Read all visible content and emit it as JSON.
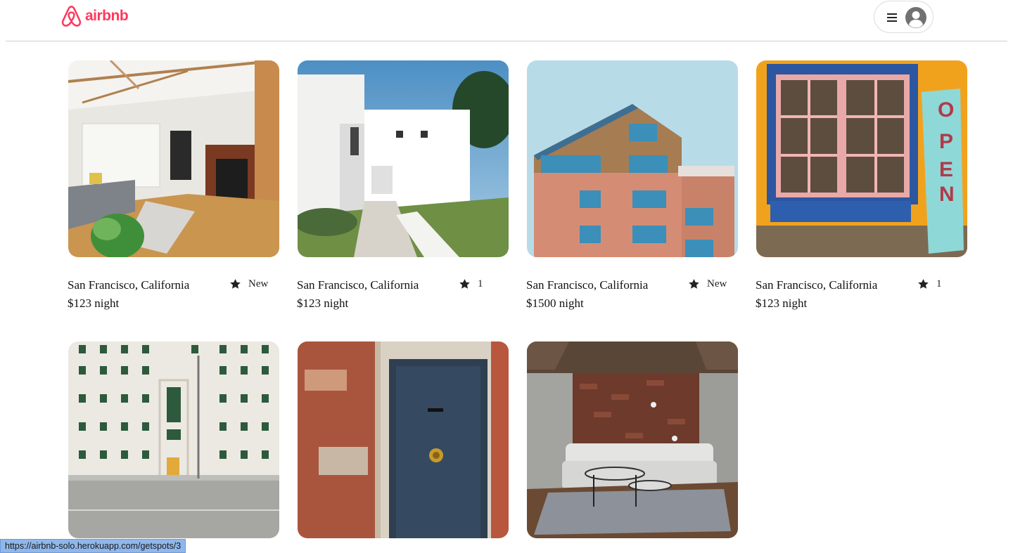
{
  "header": {
    "logo_text": "airbnb",
    "logo_icon": "airbnb-belo-icon",
    "brand_color": "#ff385c",
    "menu_icon": "hamburger-icon",
    "avatar_icon": "user-avatar-icon"
  },
  "listings": [
    {
      "location": "San Francisco, California",
      "rating": "New",
      "price": "$123 night",
      "photo": "living-room-fireplace"
    },
    {
      "location": "San Francisco, California",
      "rating": "1",
      "price": "$123 night",
      "photo": "white-modern-house"
    },
    {
      "location": "San Francisco, California",
      "rating": "New",
      "price": "$1500 night",
      "photo": "brick-wood-house"
    },
    {
      "location": "San Francisco, California",
      "rating": "1",
      "price": "$123 night",
      "photo": "open-sign-shopfront"
    },
    {
      "photo": "white-building-facade"
    },
    {
      "photo": "blue-door-brick-wall"
    },
    {
      "photo": "loft-living-room"
    }
  ],
  "status_bar": {
    "url": "https://airbnb-solo.herokuapp.com/getspots/3"
  }
}
